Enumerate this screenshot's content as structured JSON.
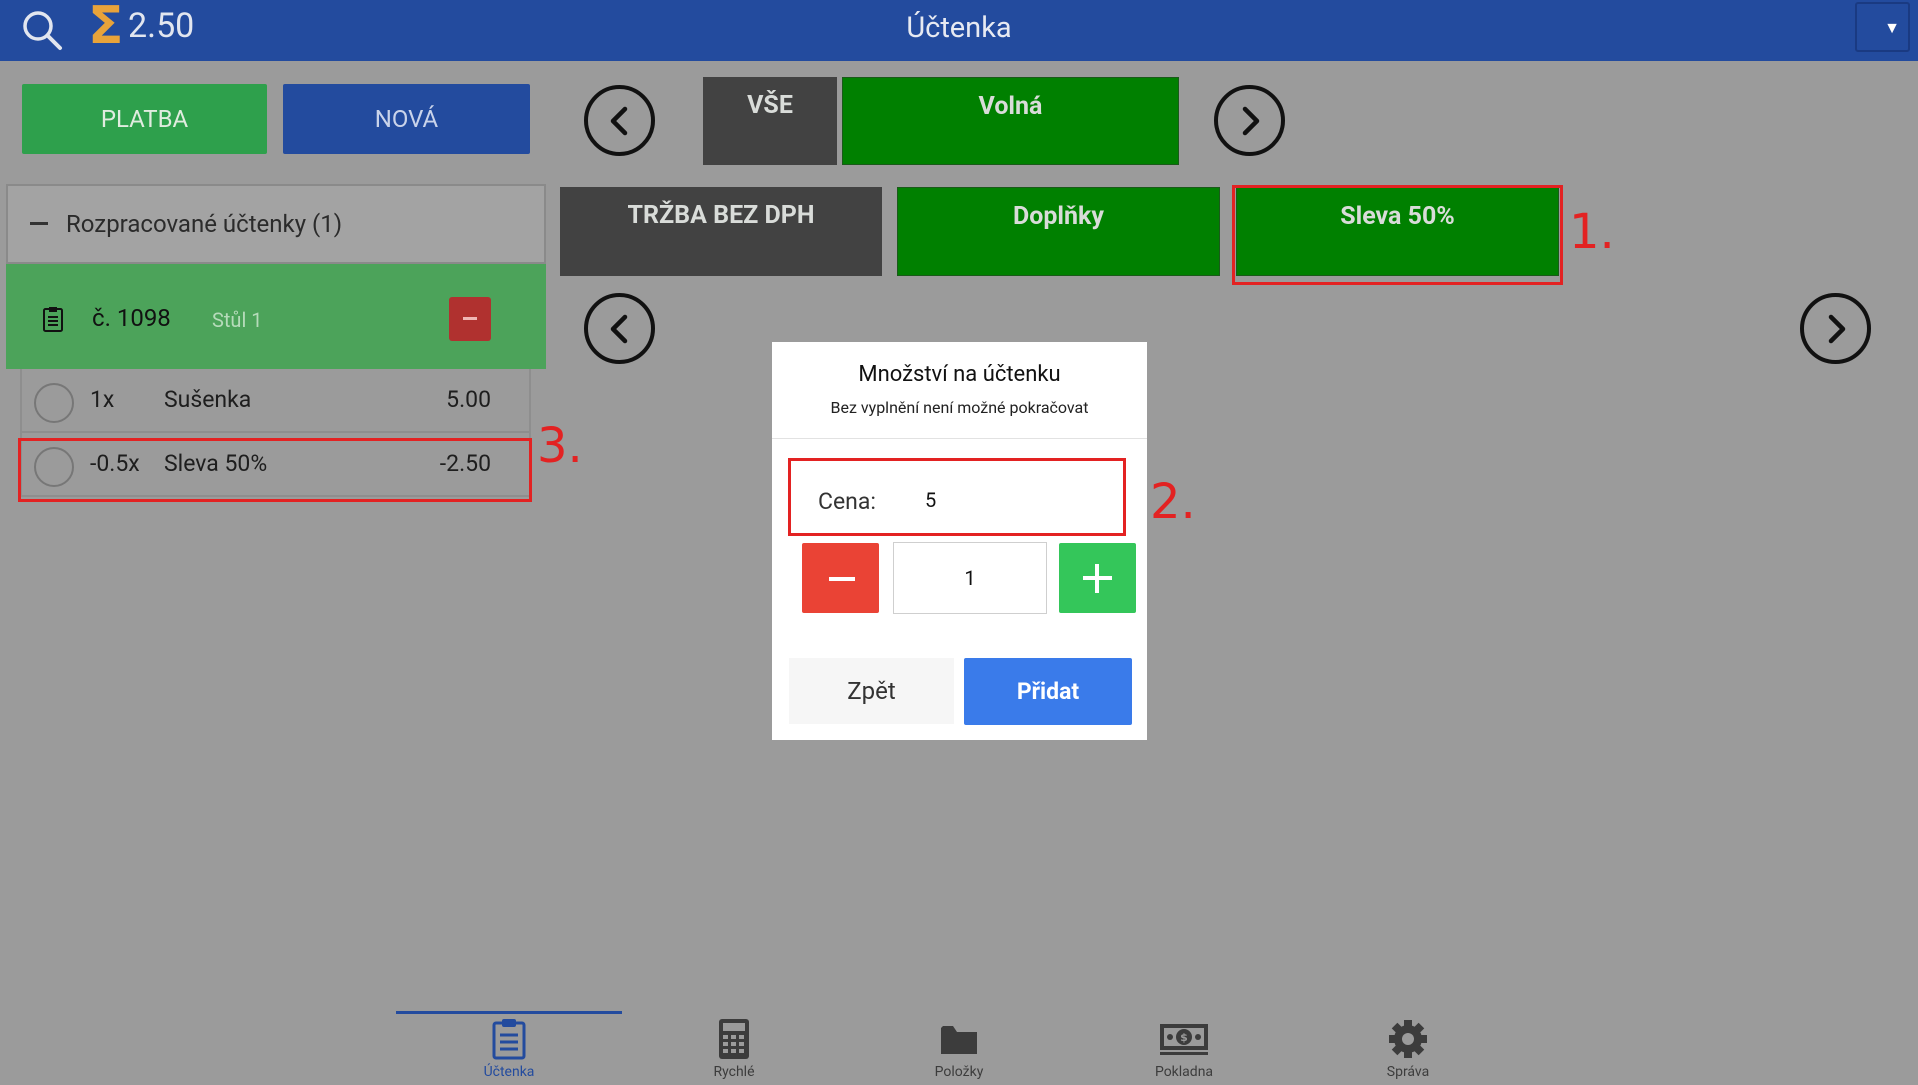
{
  "header": {
    "sigma_symbol": "Σ",
    "total": "2.50",
    "title": "Účtenka",
    "dropdown_arrow": "▼"
  },
  "actions": {
    "platba": "PLATBA",
    "nova": "NOVÁ"
  },
  "categories": {
    "row1": [
      "VŠE",
      "Volná"
    ],
    "row2": [
      "TRŽBA BEZ DPH",
      "Doplňky",
      "Sleva 50%"
    ]
  },
  "receipts_panel": {
    "header": "Rozpracované účtenky (1)",
    "receipt": {
      "number": "č. 1098",
      "table": "Stůl 1"
    },
    "items": [
      {
        "qty": "1x",
        "name": "Sušenka",
        "price": "5.00"
      },
      {
        "qty": "-0.5x",
        "name": "Sleva 50%",
        "price": "-2.50"
      }
    ]
  },
  "modal": {
    "title": "Množství na účtenku",
    "subtitle": "Bez vyplnění není možné pokračovat",
    "price_label": "Cena:",
    "price_value": "5",
    "quantity": "1",
    "back": "Zpět",
    "add": "Přidat"
  },
  "annotations": [
    "1.",
    "2.",
    "3."
  ],
  "bottom_nav": [
    {
      "label": "Účtenka",
      "icon": "clipboard-icon",
      "active": true
    },
    {
      "label": "Rychlé",
      "icon": "calculator-icon",
      "active": false
    },
    {
      "label": "Položky",
      "icon": "folder-icon",
      "active": false
    },
    {
      "label": "Pokladna",
      "icon": "cash-icon",
      "active": false
    },
    {
      "label": "Správa",
      "icon": "gear-icon",
      "active": false
    }
  ],
  "colors": {
    "header_bg": "#234b9e",
    "green_tile": "#008000",
    "dark_tile": "#424242",
    "annotation_red": "#e32222",
    "add_button": "#3a7bea"
  }
}
